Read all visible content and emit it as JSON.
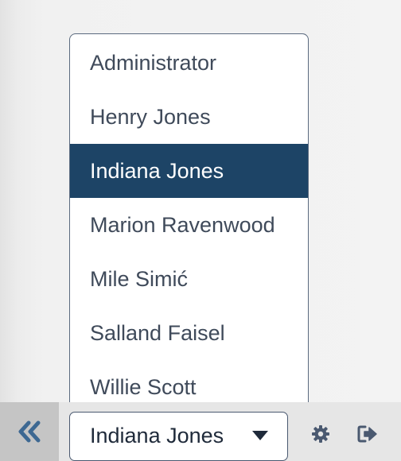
{
  "user_list": {
    "options": [
      "Administrator",
      "Henry Jones",
      "Indiana Jones",
      "Marion Ravenwood",
      "Mile Simić",
      "Salland Faisel",
      "Willie Scott"
    ],
    "selected_index": 2
  },
  "bottom_bar": {
    "selected_user": "Indiana Jones",
    "collapse_icon": "double-chevron-left-icon",
    "settings_icon": "gear-icon",
    "logout_icon": "logout-icon"
  },
  "colors": {
    "selected_bg": "#1d4466",
    "option_text": "#3f4a5a",
    "icon": "#4a5970",
    "collapse_icon": "#3d6892"
  }
}
